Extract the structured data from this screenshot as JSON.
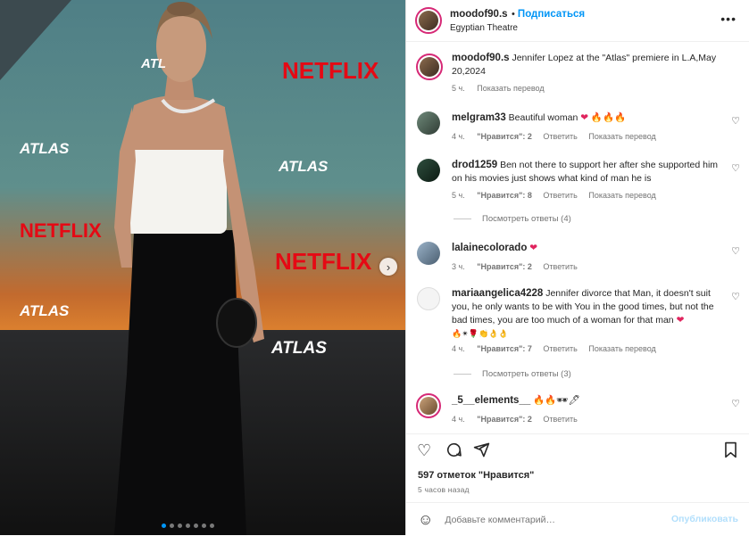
{
  "post": {
    "username": "moodof90.s",
    "follow_label": "Подписаться",
    "location": "Egyptian Theatre",
    "caption": "Jennifer Lopez at the \"Atlas\" premiere in L.A,May 20,2024",
    "caption_time": "5 ч.",
    "translate_label": "Показать перевод",
    "photo_texts": {
      "netflix": "NETFLIX",
      "atlas": "ATLAS"
    },
    "carousel": {
      "total": 7,
      "active": 1
    }
  },
  "comments": [
    {
      "username": "melgram33",
      "text": "Beautiful woman",
      "emoji": "❤ 🔥🔥🔥",
      "time": "4 ч.",
      "likes": "\"Нравится\": 2",
      "reply": "Ответить",
      "translate": "Показать перевод"
    },
    {
      "username": "drod1259",
      "text": "Ben not there to support her after she supported him on his movies just shows what kind of man he is",
      "time": "5 ч.",
      "likes": "\"Нравится\": 8",
      "reply": "Ответить",
      "translate": "Показать перевод",
      "replies": "Посмотреть ответы (4)"
    },
    {
      "username": "lalainecolorado",
      "text": "",
      "emoji": "❤",
      "time": "3 ч.",
      "likes": "\"Нравится\": 2",
      "reply": "Ответить"
    },
    {
      "username": "mariaangelica4228",
      "text": "Jennifer divorce that Man, it doesn't suit you, he only wants to be with You in the good times, but not the bad times, you are too much of a woman for that man",
      "emoji": "❤",
      "emoji_line": "🔥✴🌹👏👌👌",
      "time": "4 ч.",
      "likes": "\"Нравится\": 7",
      "reply": "Ответить",
      "translate": "Показать перевод",
      "replies": "Посмотреть ответы (3)"
    },
    {
      "username": "_5__elements__",
      "text": "",
      "emoji": "🔥🔥🕶🖊",
      "time": "4 ч.",
      "likes": "\"Нравится\": 2",
      "reply": "Ответить"
    }
  ],
  "footer": {
    "likes": "597 отметок \"Нравится\"",
    "time_ago": "5 часов назад",
    "comment_placeholder": "Добавьте комментарий…",
    "publish": "Опубликовать"
  },
  "colors": {
    "accent": "#0095f6",
    "heart": "#e0245e",
    "ring": "#d62976"
  },
  "icons": [
    "heart-icon",
    "comment-icon",
    "share-icon",
    "bookmark-icon",
    "emoji-icon",
    "more-icon",
    "chevron-right-icon"
  ]
}
